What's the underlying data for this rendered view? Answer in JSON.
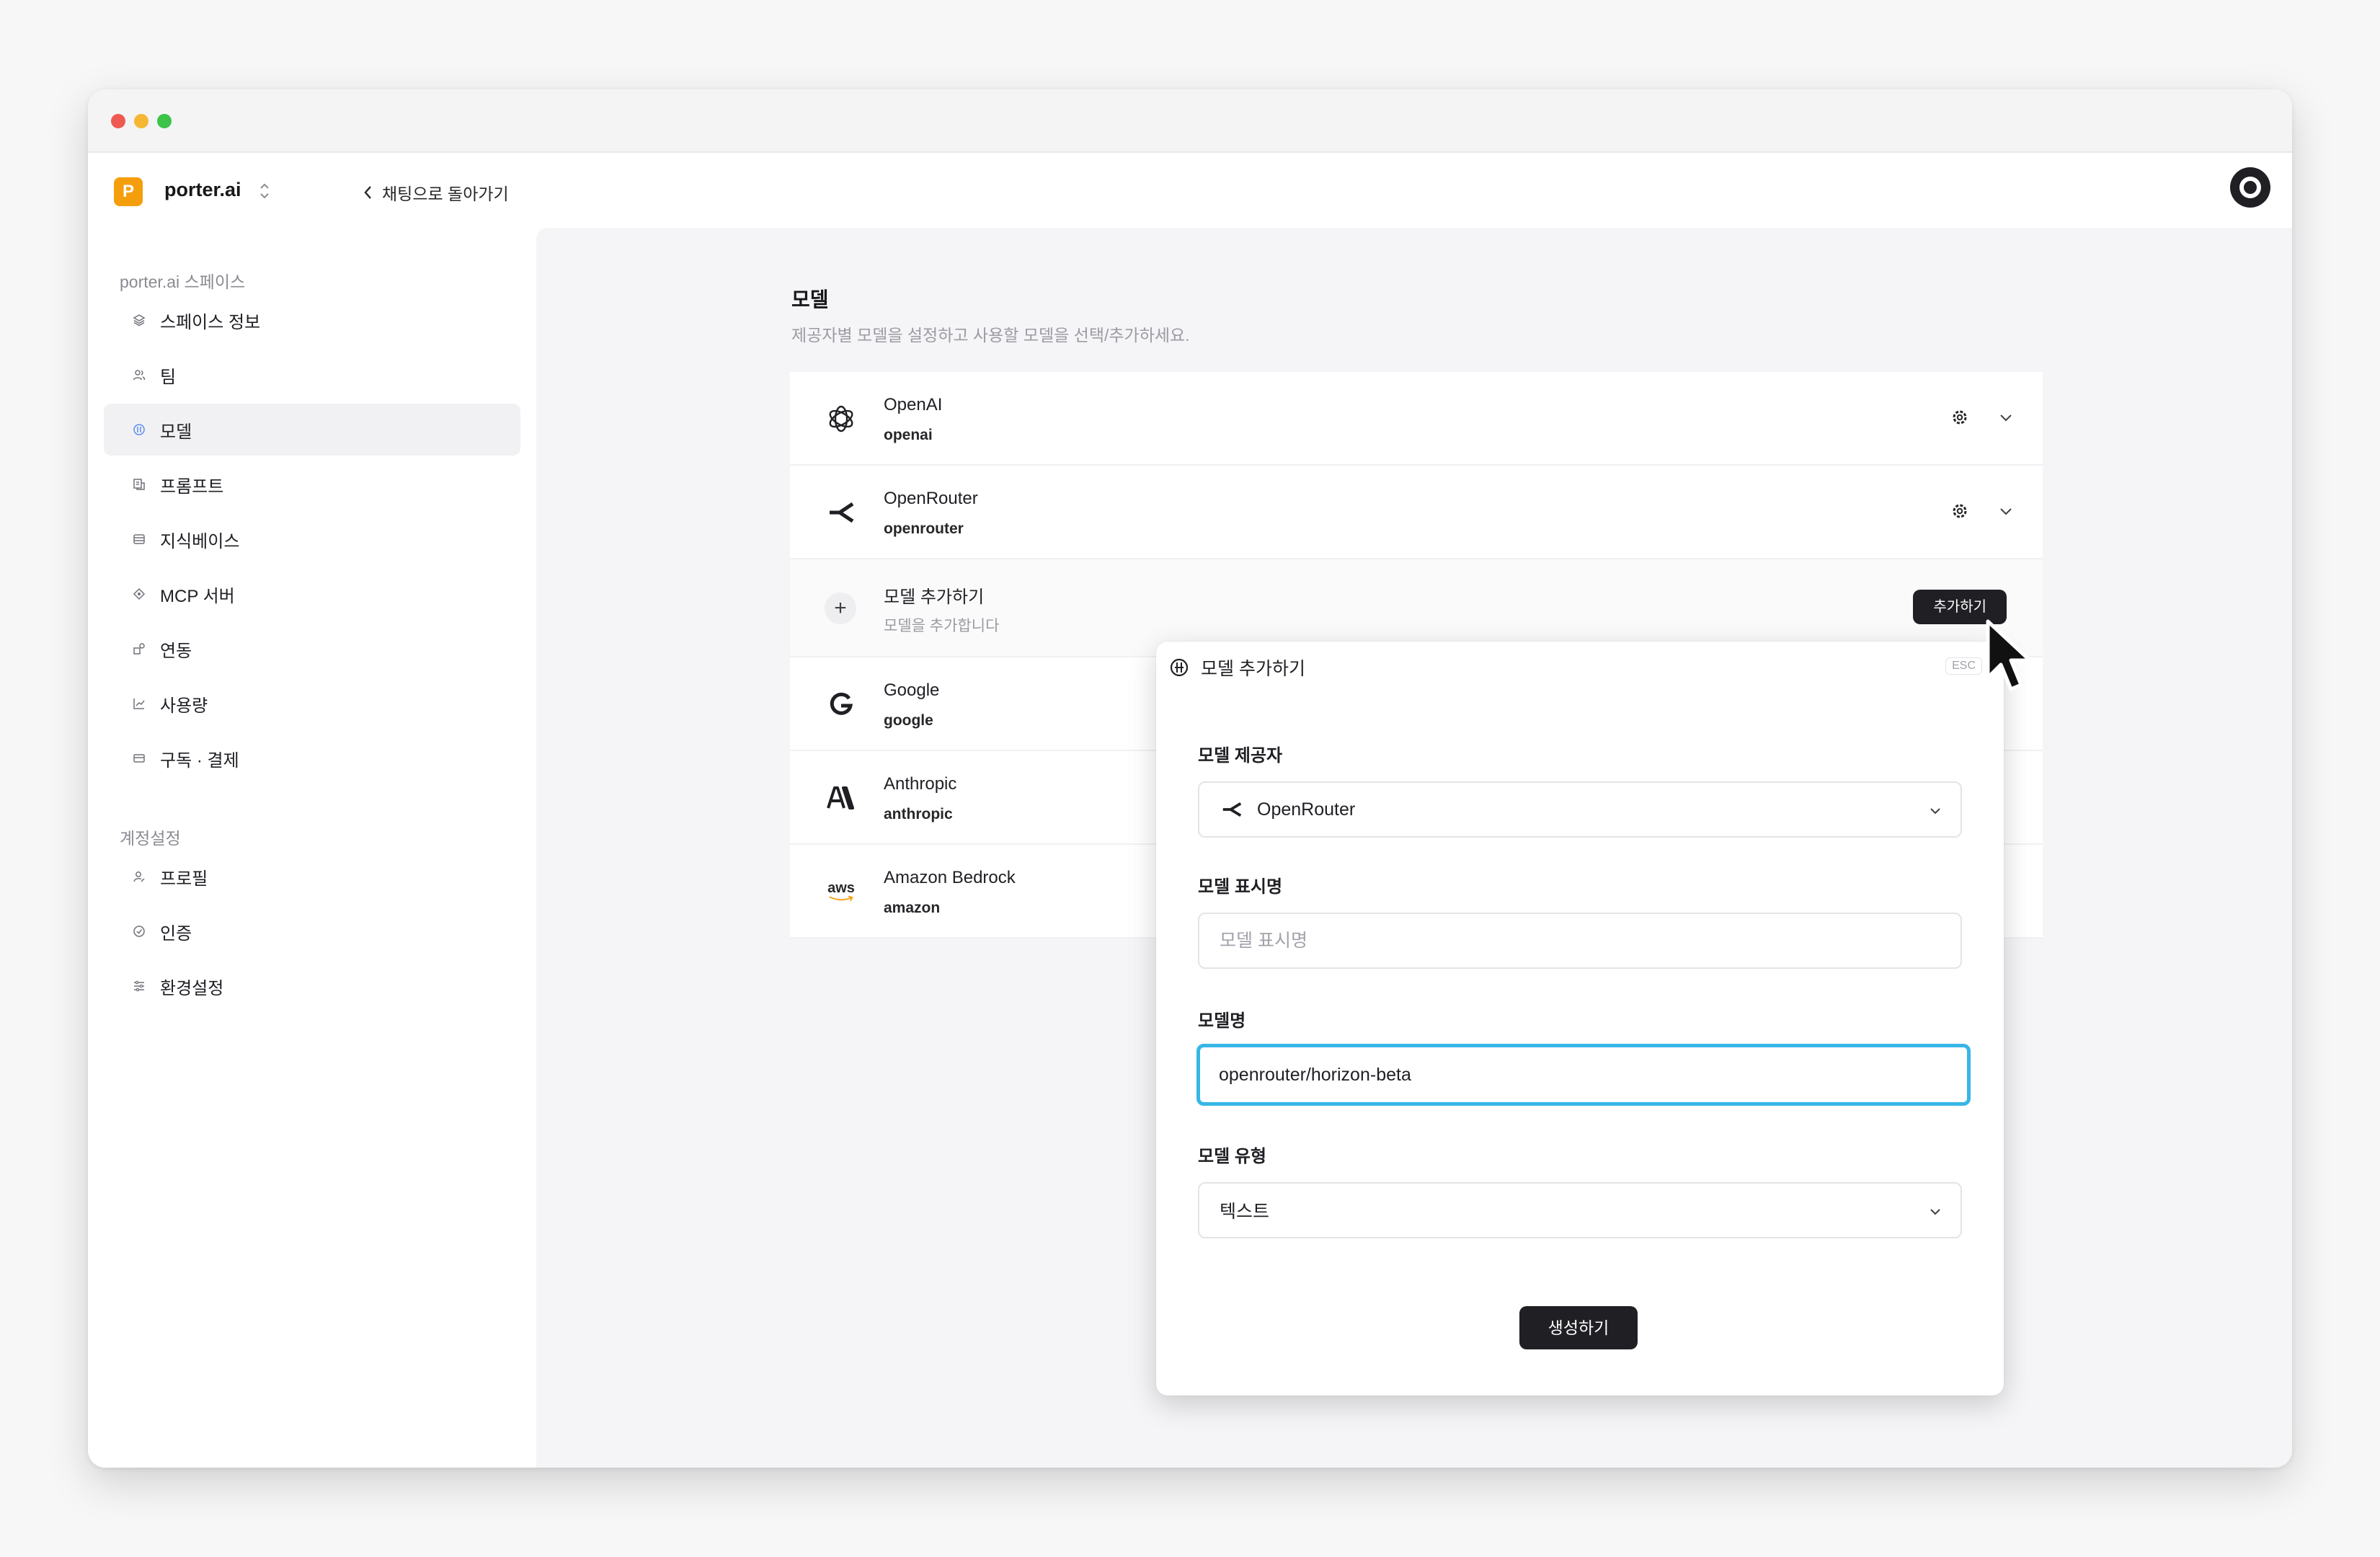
{
  "brand": {
    "logo_letter": "P",
    "name": "porter.ai",
    "color": "#f59e0b"
  },
  "topbar": {
    "back_label": "채팅으로 돌아가기"
  },
  "sidebar": {
    "space_section": "porter.ai 스페이스",
    "space_items": [
      {
        "label": "스페이스 정보",
        "icon": "layers-icon"
      },
      {
        "label": "팀",
        "icon": "users-icon"
      },
      {
        "label": "모델",
        "icon": "model-icon"
      },
      {
        "label": "프롬프트",
        "icon": "prompt-icon"
      },
      {
        "label": "지식베이스",
        "icon": "database-icon"
      },
      {
        "label": "MCP 서버",
        "icon": "server-icon"
      },
      {
        "label": "연동",
        "icon": "integration-icon"
      },
      {
        "label": "사용량",
        "icon": "chart-icon"
      },
      {
        "label": "구독 · 결제",
        "icon": "card-icon"
      }
    ],
    "account_section": "계정설정",
    "account_items": [
      {
        "label": "프로필",
        "icon": "profile-icon"
      },
      {
        "label": "인증",
        "icon": "shield-icon"
      },
      {
        "label": "환경설정",
        "icon": "settings-sliders-icon"
      }
    ]
  },
  "main": {
    "title": "모델",
    "description": "제공자별 모델을 설정하고 사용할 모델을 선택/추가하세요.",
    "providers": [
      {
        "name": "OpenAI",
        "slug": "openai"
      },
      {
        "name": "OpenRouter",
        "slug": "openrouter"
      }
    ],
    "add_row": {
      "title": "모델 추가하기",
      "subtitle": "모델을 추가합니다",
      "button": "추가하기"
    },
    "providers_more": [
      {
        "name": "Google",
        "slug": "google"
      },
      {
        "name": "Anthropic",
        "slug": "anthropic"
      },
      {
        "name": "Amazon Bedrock",
        "slug": "amazon",
        "logo_text": "aws"
      }
    ]
  },
  "modal": {
    "title": "모델 추가하기",
    "esc": "ESC",
    "provider_label": "모델 제공자",
    "provider_value": "OpenRouter",
    "display_label": "모델 표시명",
    "display_placeholder": "모델 표시명",
    "model_label": "모델명",
    "model_value": "openrouter/horizon-beta",
    "type_label": "모델 유형",
    "type_value": "텍스트",
    "create_button": "생성하기",
    "focus_color": "#38b6e6"
  }
}
